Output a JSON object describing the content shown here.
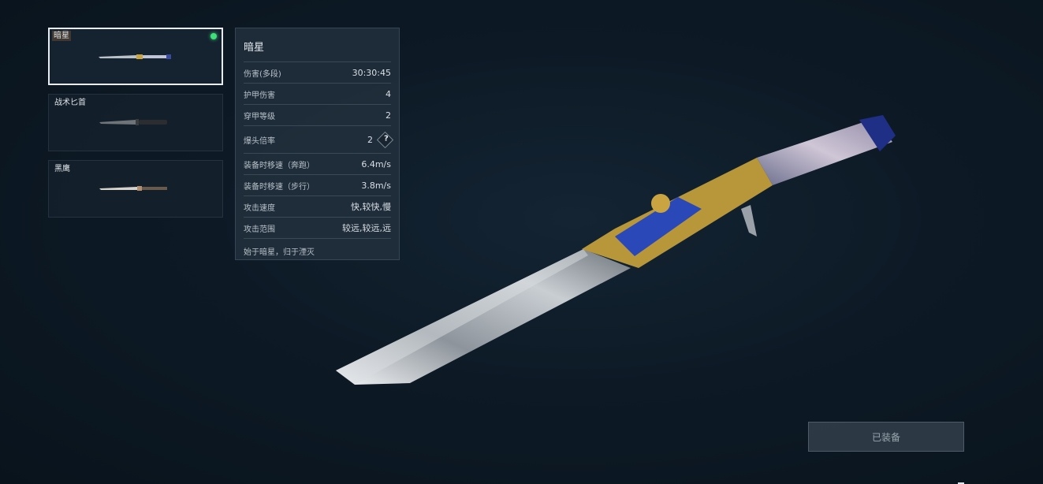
{
  "weapon_list": [
    {
      "name": "暗星",
      "selected": true,
      "equipped": true
    },
    {
      "name": "战术匕首",
      "selected": false,
      "equipped": false
    },
    {
      "name": "黑鹰",
      "selected": false,
      "equipped": false
    }
  ],
  "stats_panel": {
    "title": "暗星",
    "rows": [
      {
        "label": "伤害(多段)",
        "value": "30:30:45"
      },
      {
        "label": "护甲伤害",
        "value": "4"
      },
      {
        "label": "穿甲等级",
        "value": "2"
      },
      {
        "label": "爆头倍率",
        "value": "2",
        "help": "?"
      },
      {
        "label": "装备时移速（奔跑）",
        "value": "6.4m/s"
      },
      {
        "label": "装备时移速（步行）",
        "value": "3.8m/s"
      },
      {
        "label": "攻击速度",
        "value": "快,较快,慢"
      },
      {
        "label": "攻击范围",
        "value": "较远,较远,远"
      }
    ],
    "description": "始于暗星，归于湮灭"
  },
  "equip_button": {
    "label": "已装备"
  },
  "colors": {
    "equipped_dot": "#3fe07c",
    "panel_bg": "#22303d",
    "background": "#0d1a26"
  }
}
